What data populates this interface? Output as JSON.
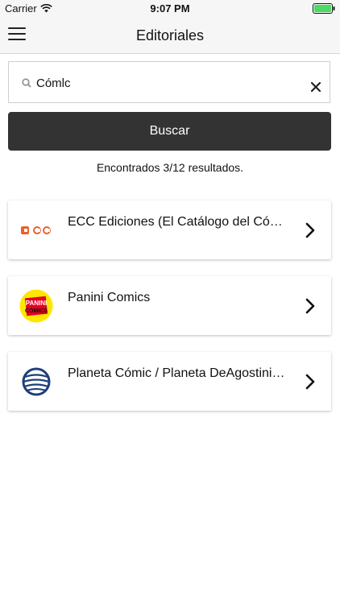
{
  "status_bar": {
    "carrier": "Carrier",
    "time": "9:07 PM"
  },
  "nav": {
    "title": "Editoriales"
  },
  "search": {
    "value": "Cómlc",
    "placeholder": ""
  },
  "button": {
    "label": "Buscar"
  },
  "results_text": "Encontrados 3/12 resultados.",
  "publishers": [
    {
      "name": "ECC Ediciones (El Catálogo del Cómic)",
      "logo": "ecc-logo"
    },
    {
      "name": "Panini Comics",
      "logo": "panini-logo",
      "logo_text_1": "PANINI",
      "logo_text_2": "COMICS"
    },
    {
      "name": "Planeta Cómic / Planeta DeAgostini Cómics",
      "logo": "planeta-logo"
    }
  ],
  "colors": {
    "button_bg": "#333333",
    "panini_yellow": "#ffe600",
    "planeta_blue": "#1d3f7a",
    "ecc_orange": "#e8612c"
  }
}
